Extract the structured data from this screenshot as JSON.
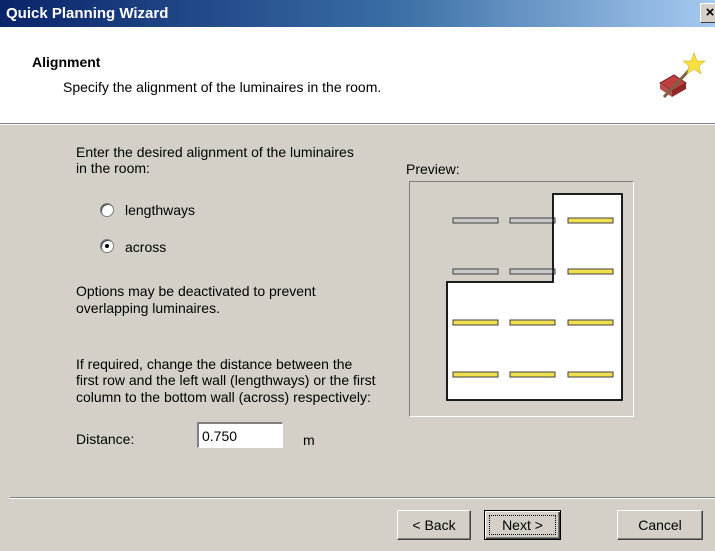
{
  "window": {
    "title": "Quick Planning Wizard",
    "close_glyph": "×"
  },
  "header": {
    "title": "Alignment",
    "subtitle": "Specify the alignment of the luminaires in the room.",
    "icon": "wizard-wand-icon"
  },
  "body": {
    "intro_line1": "Enter the desired alignment of the luminaires",
    "intro_line2": "in the room:",
    "options": [
      {
        "label": "lengthways",
        "checked": false
      },
      {
        "label": "across",
        "checked": true
      }
    ],
    "note_line1": "Options may be deactivated to prevent",
    "note_line2": "overlapping luminaires.",
    "distance_help_line1": "If required, change the distance between the",
    "distance_help_line2": "first row and the left wall (lengthways) or the first",
    "distance_help_line3": "column to the bottom wall (across) respectively:",
    "distance_label": "Distance:",
    "distance_value": "0.750",
    "distance_unit": "m"
  },
  "preview": {
    "label": "Preview:",
    "luminaire_color_active": "#f0e050",
    "luminaire_color_inactive": "#c8c8c8"
  },
  "footer": {
    "back_label": "< Back",
    "next_label": "Next >",
    "cancel_label": "Cancel"
  }
}
